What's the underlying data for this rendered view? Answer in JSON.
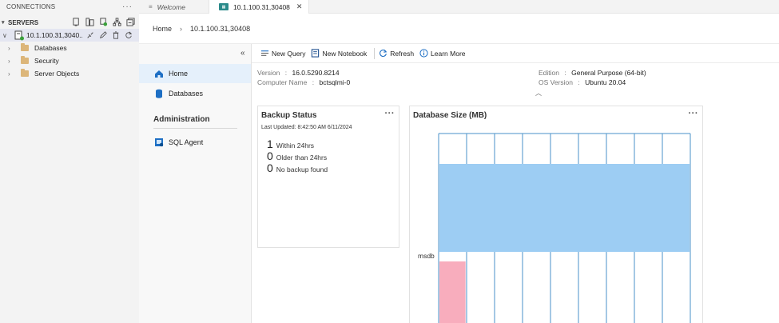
{
  "connections": {
    "header": "CONNECTIONS",
    "more": "···",
    "servers_label": "SERVERS",
    "server": {
      "label": "10.1.100.31,3040..."
    },
    "tree": [
      {
        "label": "Databases"
      },
      {
        "label": "Security"
      },
      {
        "label": "Server Objects"
      }
    ]
  },
  "tabs": [
    {
      "label": "Welcome",
      "icon": "file-icon"
    },
    {
      "label": "10.1.100.31,30408",
      "icon": "server-dashboard-icon",
      "close": "✕"
    }
  ],
  "breadcrumb": {
    "home": "Home",
    "server": "10.1.100.31,30408"
  },
  "nav": {
    "items": [
      {
        "label": "Home",
        "icon": "home-icon"
      },
      {
        "label": "Databases",
        "icon": "database-icon"
      }
    ],
    "section_heading": "Administration",
    "admin_items": [
      {
        "label": "SQL Agent",
        "icon": "sql-agent-icon"
      }
    ]
  },
  "toolbar": {
    "new_query": "New Query",
    "new_notebook": "New Notebook",
    "refresh": "Refresh",
    "learn_more": "Learn More"
  },
  "properties": {
    "version_key": "Version",
    "version_val": "16.0.5290.8214",
    "computer_key": "Computer Name",
    "computer_val": "bctsqlmi-0",
    "edition_key": "Edition",
    "edition_val": "General Purpose (64-bit)",
    "os_key": "OS Version",
    "os_val": "Ubuntu 20.04",
    "separator": ":"
  },
  "backup": {
    "title": "Backup Status",
    "updated": "Last Updated: 8:42:50 AM 6/11/2024",
    "rows": [
      {
        "count": "1",
        "label": "Within 24hrs"
      },
      {
        "count": "0",
        "label": "Older than 24hrs"
      },
      {
        "count": "0",
        "label": "No backup found"
      }
    ],
    "more": "···"
  },
  "dbsize": {
    "title": "Database Size (MB)",
    "more": "···",
    "colors": {
      "blue": "#9dcdf3",
      "pink": "#f8adbd",
      "grid": "#4a90c8"
    },
    "chart_data": {
      "type": "bar",
      "categories": [
        "msdb"
      ],
      "series": [
        {
          "name": "",
          "values": [
            100
          ]
        },
        {
          "name": "",
          "values": [
            11
          ]
        }
      ]
    }
  }
}
